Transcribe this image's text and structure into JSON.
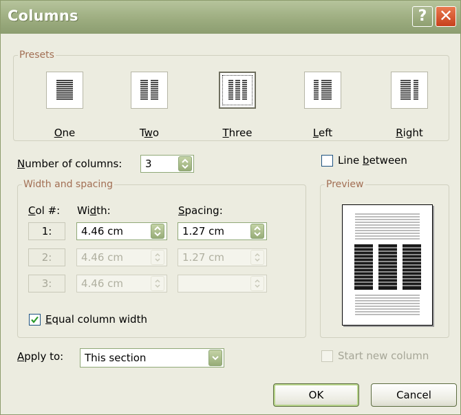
{
  "dialog": {
    "title": "Columns",
    "help_glyph": "?",
    "close_glyph": "✕"
  },
  "presets": {
    "legend": "Presets",
    "items": [
      {
        "pre": "",
        "key": "O",
        "post": "ne"
      },
      {
        "pre": "T",
        "key": "w",
        "post": "o"
      },
      {
        "pre": "",
        "key": "T",
        "post": "hree"
      },
      {
        "pre": "",
        "key": "L",
        "post": "eft"
      },
      {
        "pre": "",
        "key": "R",
        "post": "ight"
      }
    ],
    "selected": "Three"
  },
  "number_of_columns": {
    "label_key": "N",
    "label_rest": "umber of columns:",
    "value": "3"
  },
  "line_between": {
    "label_pre": "Line ",
    "label_key": "b",
    "label_post": "etween",
    "checked": false
  },
  "width_spacing": {
    "legend": "Width and spacing",
    "col_header_key": "C",
    "col_header_rest": "ol #:",
    "width_header_pre": "Wi",
    "width_header_key": "d",
    "width_header_post": "th:",
    "spacing_header_key": "S",
    "spacing_header_rest": "pacing:",
    "rows": [
      {
        "col": "1:",
        "width": "4.46 cm",
        "spacing": "1.27 cm",
        "enabled": true
      },
      {
        "col": "2:",
        "width": "4.46 cm",
        "spacing": "1.27 cm",
        "enabled": false
      },
      {
        "col": "3:",
        "width": "4.46 cm",
        "spacing": "",
        "enabled": false
      }
    ]
  },
  "equal_width": {
    "label_key": "E",
    "label_rest": "qual column width",
    "checked": true
  },
  "preview": {
    "legend": "Preview"
  },
  "apply_to": {
    "label_key": "A",
    "label_rest": "pply to:",
    "value": "This section"
  },
  "start_new_column": {
    "label": "Start new column",
    "checked": false,
    "enabled": false
  },
  "buttons": {
    "ok": "OK",
    "cancel": "Cancel"
  },
  "colors": {
    "title_bar": "#9DAD80",
    "dialog_bg": "#ECECE0",
    "group_legend": "#A26F54",
    "close_button": "#C7401C",
    "checkbox_mark": "#2A9A2A"
  }
}
